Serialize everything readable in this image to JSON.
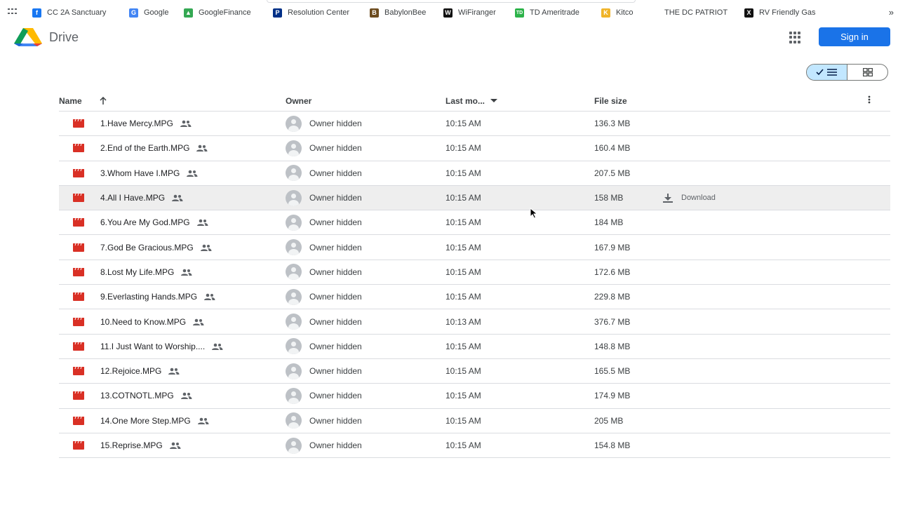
{
  "bookmarks": [
    {
      "label": "CC 2A Sanctuary",
      "icon": "facebook-icon",
      "color": "#1877f2",
      "glyph": "f"
    },
    {
      "label": "Google",
      "icon": "google-icon",
      "color": "#4285f4",
      "glyph": "G"
    },
    {
      "label": "GoogleFinance",
      "icon": "google-finance-icon",
      "color": "#34a853",
      "glyph": "▲"
    },
    {
      "label": "Resolution Center",
      "icon": "paypal-icon",
      "color": "#003087",
      "glyph": "P"
    },
    {
      "label": "BabylonBee",
      "icon": "babylonbee-icon",
      "color": "#6d4c1f",
      "glyph": "B"
    },
    {
      "label": "WiFiranger",
      "icon": "wifiranger-icon",
      "color": "#111111",
      "glyph": "W"
    },
    {
      "label": "TD Ameritrade",
      "icon": "td-icon",
      "color": "#2db34a",
      "glyph": "TD"
    },
    {
      "label": "Kitco",
      "icon": "kitco-icon",
      "color": "#f0b429",
      "glyph": "K"
    },
    {
      "label": "THE DC PATRIOT",
      "icon": "",
      "color": "",
      "glyph": ""
    },
    {
      "label": "RV Friendly Gas",
      "icon": "x-icon",
      "color": "#111111",
      "glyph": "X"
    }
  ],
  "bookmarks_more": "»",
  "header": {
    "title": "Drive",
    "signin_label": "Sign in"
  },
  "table": {
    "columns": {
      "name": "Name",
      "owner": "Owner",
      "modified": "Last mo...",
      "size": "File size"
    },
    "download_label": "Download",
    "rows": [
      {
        "name": "1.Have Mercy.MPG",
        "owner": "Owner hidden",
        "modified": "10:15 AM",
        "size": "136.3 MB"
      },
      {
        "name": "2.End of the Earth.MPG",
        "owner": "Owner hidden",
        "modified": "10:15 AM",
        "size": "160.4 MB"
      },
      {
        "name": "3.Whom Have I.MPG",
        "owner": "Owner hidden",
        "modified": "10:15 AM",
        "size": "207.5 MB"
      },
      {
        "name": "4.All I Have.MPG",
        "owner": "Owner hidden",
        "modified": "10:15 AM",
        "size": "158 MB",
        "hover": true
      },
      {
        "name": "6.You Are My God.MPG",
        "owner": "Owner hidden",
        "modified": "10:15 AM",
        "size": "184 MB"
      },
      {
        "name": "7.God Be Gracious.MPG",
        "owner": "Owner hidden",
        "modified": "10:15 AM",
        "size": "167.9 MB"
      },
      {
        "name": "8.Lost My Life.MPG",
        "owner": "Owner hidden",
        "modified": "10:15 AM",
        "size": "172.6 MB"
      },
      {
        "name": "9.Everlasting Hands.MPG",
        "owner": "Owner hidden",
        "modified": "10:15 AM",
        "size": "229.8 MB"
      },
      {
        "name": "10.Need to Know.MPG",
        "owner": "Owner hidden",
        "modified": "10:13 AM",
        "size": "376.7 MB"
      },
      {
        "name": "11.I Just Want to Worship....",
        "owner": "Owner hidden",
        "modified": "10:15 AM",
        "size": "148.8 MB"
      },
      {
        "name": "12.Rejoice.MPG",
        "owner": "Owner hidden",
        "modified": "10:15 AM",
        "size": "165.5 MB"
      },
      {
        "name": "13.COTNOTL.MPG",
        "owner": "Owner hidden",
        "modified": "10:15 AM",
        "size": "174.9 MB"
      },
      {
        "name": "14.One More Step.MPG",
        "owner": "Owner hidden",
        "modified": "10:15 AM",
        "size": "205 MB"
      },
      {
        "name": "15.Reprise.MPG",
        "owner": "Owner hidden",
        "modified": "10:15 AM",
        "size": "154.8 MB"
      }
    ]
  },
  "colors": {
    "accent": "#1a73e8",
    "video_icon": "#d93025",
    "view_toggle_selected": "#c2e7ff"
  }
}
